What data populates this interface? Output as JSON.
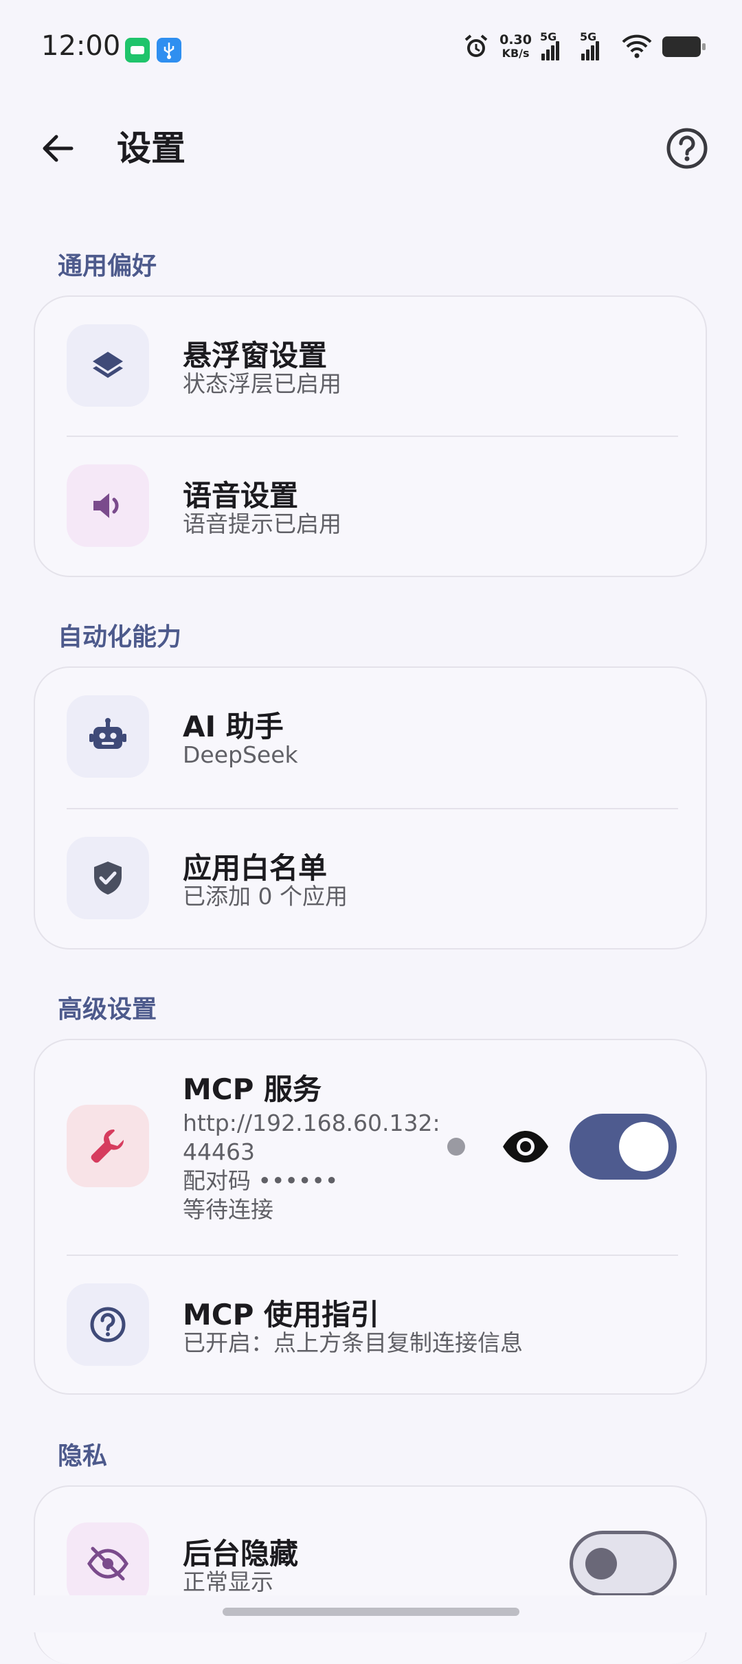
{
  "status_bar": {
    "time": "12:00",
    "speed_value": "0.30",
    "speed_unit": "KB/s",
    "network_1": "5G",
    "network_2": "5G"
  },
  "header": {
    "title": "设置"
  },
  "sections": {
    "general": {
      "title": "通用偏好",
      "floating": {
        "title": "悬浮窗设置",
        "subtitle": "状态浮层已启用"
      },
      "voice": {
        "title": "语音设置",
        "subtitle": "语音提示已启用"
      }
    },
    "automation": {
      "title": "自动化能力",
      "ai": {
        "title": "AI 助手",
        "subtitle": "DeepSeek"
      },
      "whitelist": {
        "title": "应用白名单",
        "subtitle": "已添加 0 个应用"
      }
    },
    "advanced": {
      "title": "高级设置",
      "mcp": {
        "title": "MCP 服务",
        "url_line1": "http://192.168.60.132:",
        "url_line2": "44463",
        "pair_code": "配对码 ••••••",
        "status": "等待连接",
        "enabled": true
      },
      "guide": {
        "title": "MCP 使用指引",
        "subtitle": "已开启：点上方条目复制连接信息"
      }
    },
    "privacy": {
      "title": "隐私",
      "hide": {
        "title": "后台隐藏",
        "subtitle": "正常显示",
        "enabled": false
      }
    }
  },
  "icons": {
    "back": "arrow-back-icon",
    "help": "help-circle-icon",
    "floating": "layers-icon",
    "voice": "speaker-icon",
    "ai": "robot-icon",
    "whitelist": "shield-check-icon",
    "mcp": "wrench-icon",
    "guide": "question-circle-icon",
    "hide": "eye-off-icon"
  },
  "colors": {
    "accent": "#4e5b8f",
    "section_header": "#4d5a8c",
    "mcp_icon": "#d63c5e",
    "voice_icon": "#7a4b8c"
  }
}
